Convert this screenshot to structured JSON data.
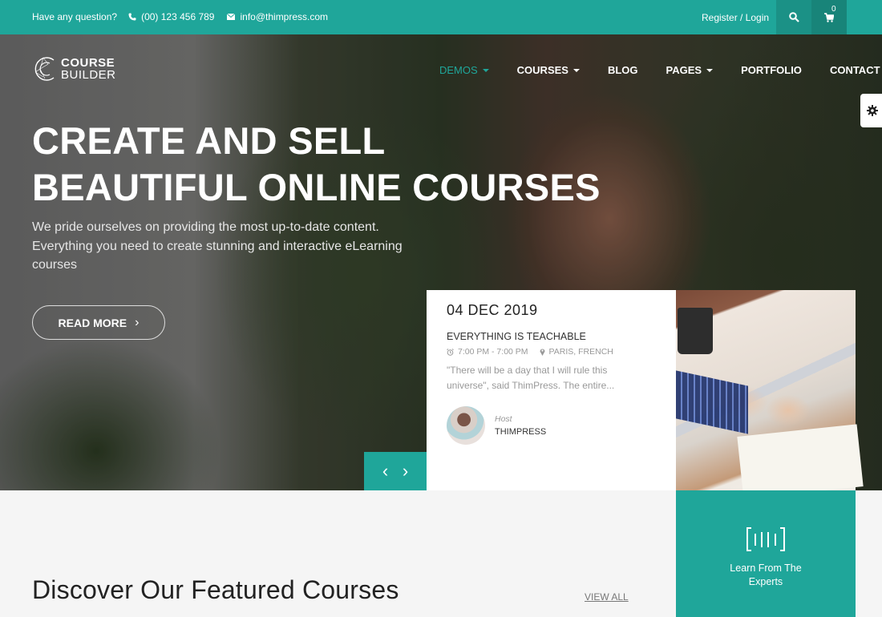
{
  "topbar": {
    "question": "Have any question?",
    "phone": "(00) 123 456 789",
    "email": "info@thimpress.com",
    "register_login": "Register / Login",
    "cart_count": "0",
    "icons": {
      "phone": "phone-icon",
      "email": "envelope-icon",
      "search": "search-icon",
      "cart": "cart-icon"
    }
  },
  "brand": {
    "line1": "COURSE",
    "line2": "BUILDER",
    "accent_color": "#1fa69a"
  },
  "nav": {
    "items": [
      {
        "label": "DEMOS",
        "has_dropdown": true,
        "active": true
      },
      {
        "label": "COURSES",
        "has_dropdown": true,
        "active": false
      },
      {
        "label": "BLOG",
        "has_dropdown": false,
        "active": false
      },
      {
        "label": "PAGES",
        "has_dropdown": true,
        "active": false
      },
      {
        "label": "PORTFOLIO",
        "has_dropdown": false,
        "active": false
      },
      {
        "label": "CONTACT",
        "has_dropdown": false,
        "active": false
      }
    ]
  },
  "hero": {
    "title_line1": "CREATE AND SELL",
    "title_line2": "BEAUTIFUL ONLINE COURSES",
    "subtitle": "We pride ourselves on providing the most up-to-date content. Everything you need to create stunning and interactive eLearning courses",
    "cta_label": "READ MORE",
    "prev_label": "‹",
    "next_label": "›"
  },
  "event": {
    "date": "04 DEC 2019",
    "title": "EVERYTHING IS TEACHABLE",
    "time": "7:00 PM - 7:00 PM",
    "location": "PARIS, FRENCH",
    "description": "\"There will be a day that I will rule this universe\", said ThimPress. The entire...",
    "host_label": "Host",
    "host_name": "THIMPRESS"
  },
  "feature": {
    "label": "Learn From The Experts"
  },
  "featured": {
    "title": "Discover Our Featured Courses",
    "view_all": "VIEW ALL"
  }
}
